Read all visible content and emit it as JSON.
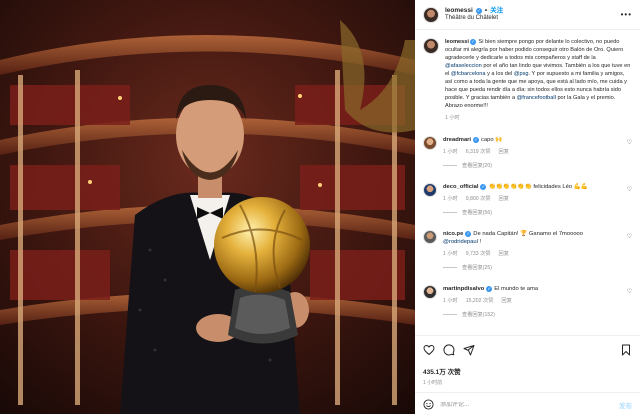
{
  "header": {
    "username": "leomessi",
    "follow_sep": "•",
    "follow_label": "关注",
    "location": "Théâtre du Châtelet",
    "more": "•••"
  },
  "caption": {
    "username": "leomessi",
    "text_1": " Si bien siempre pongo por delante lo colectivo, no puedo ocultar mi alegría por haber podido conseguir otro Balón de Oro. Quiero agradecerle y dedicarle a todos mis compañeros y staff de la ",
    "mention_1": "@afaseleccion",
    "text_2": " por el año tan lindo que vivimos. También a los que tuve en el ",
    "mention_2": "@fcbarcelona",
    "text_3": " y a los del ",
    "mention_3": "@psg",
    "text_4": ". Y por supuesto a mi familia y amigos, así como a toda la gente que me apoya, que está al lado mío, me cuida y hace que pueda rendir día a día: sin todos ellos esto nunca habría sido posible. Y gracias también a ",
    "mention_4": "@francefootball",
    "text_5": " por la Gala y el premio. Abrazo enorme!!!",
    "time": "1 小时"
  },
  "comments": [
    {
      "username": "dreadmari",
      "text": "capo 🙌",
      "time": "1 小时",
      "likes": "6,319 次赞",
      "reply": "回复",
      "view_replies": "查看回复(20)"
    },
    {
      "username": "deco_official",
      "text": "👏👏👏👏👏👏 felicidades Léo 💪💪",
      "time": "1 小时",
      "likes": "9,800 次赞",
      "reply": "回复",
      "view_replies": "查看回复(56)"
    },
    {
      "username": "nico.pe",
      "text": "De nada Capitán! 🏆 Ganamo el 7mooooo ",
      "mention": "@rodridepaul",
      "text_after": " !",
      "time": "1 小时",
      "likes": "9,733 次赞",
      "reply": "回复",
      "view_replies": "查看回复(25)"
    },
    {
      "username": "martinpdisalvo",
      "text": "El mundo te ama",
      "time": "1 小时",
      "likes": "15,202 次赞",
      "reply": "回复",
      "view_replies": "查看回复(152)"
    }
  ],
  "footer": {
    "likes": "435.1万 次赞",
    "time": "1 小时前",
    "add_comment_placeholder": "添加评论...",
    "post_label": "发布"
  },
  "icons": {
    "like": "heart-icon",
    "comment": "comment-icon",
    "share": "share-icon",
    "save": "bookmark-icon",
    "emoji": "emoji-icon",
    "verified": "verified-badge-icon",
    "more": "more-icon"
  },
  "colors": {
    "link": "#00376b",
    "follow": "#0095f6",
    "verified": "#3897f0",
    "muted": "#8e8e8e"
  }
}
